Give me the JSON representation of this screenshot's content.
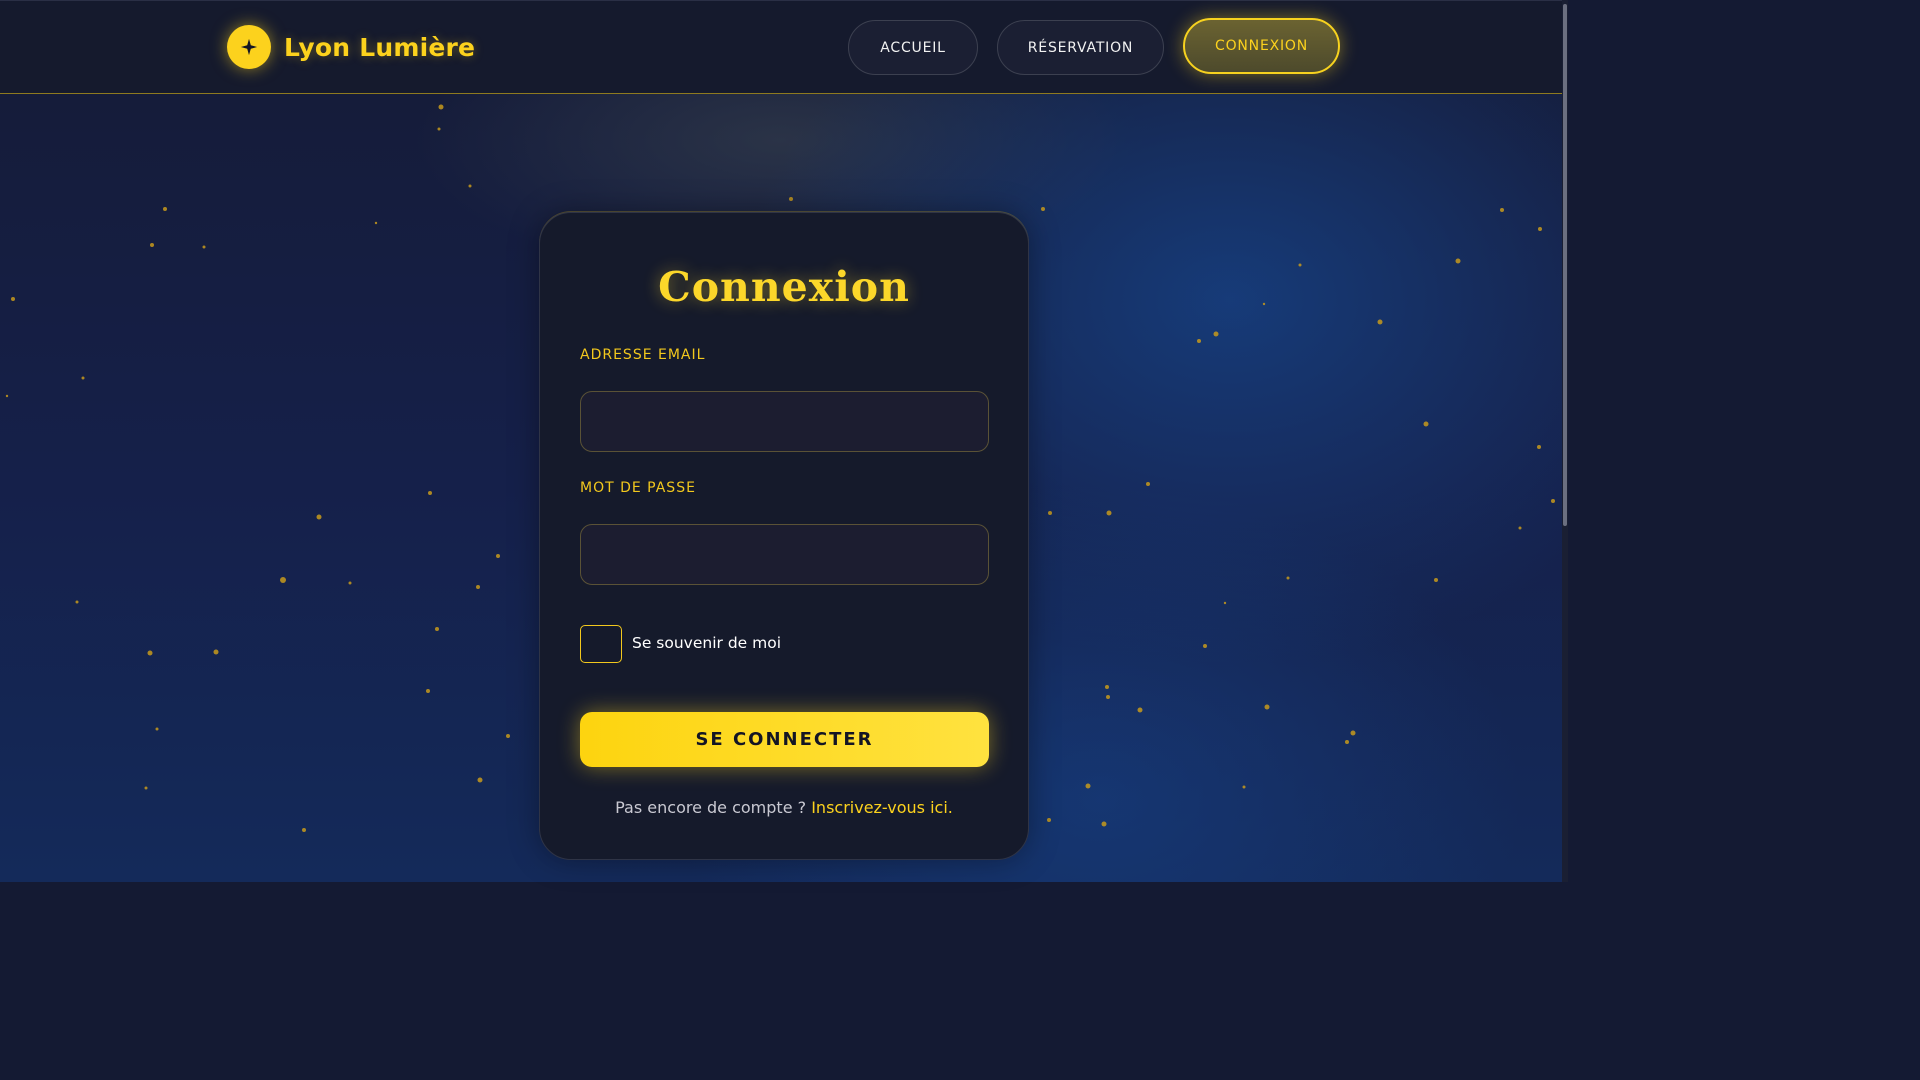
{
  "brand": {
    "name": "Lyon Lumière",
    "icon": "sparkle-icon"
  },
  "nav": {
    "items": [
      {
        "label": "ACCUEIL"
      },
      {
        "label": "RÉSERVATION"
      },
      {
        "label": "CONNEXION",
        "active": true
      }
    ]
  },
  "form": {
    "title": "Connexion",
    "email_label": "ADRESSE EMAIL",
    "email_value": "",
    "password_label": "MOT DE PASSE",
    "password_value": "",
    "remember_label": "Se souvenir de moi",
    "remember_checked": false,
    "submit_label": "SE CONNECTER",
    "signup_prompt": "Pas encore de compte ? ",
    "signup_link": "Inscrivez-vous ici."
  },
  "colors": {
    "accent": "#fcd21d",
    "background": "#151b36",
    "card": "#151a2b"
  }
}
